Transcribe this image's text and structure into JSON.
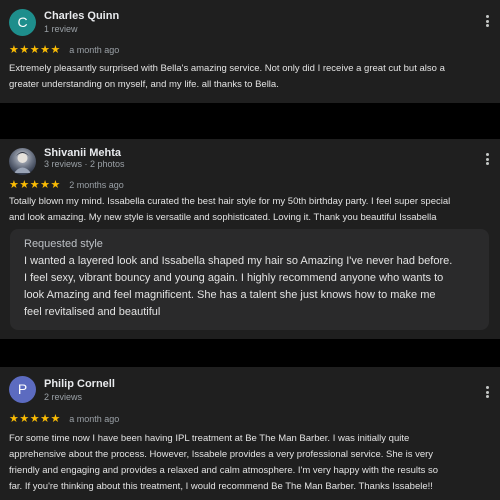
{
  "reviews": [
    {
      "initial": "C",
      "avatar_color": "#1e8e8c",
      "name": "Charles Quinn",
      "meta": "1 review",
      "stars": "★★★★★",
      "time": "a month ago",
      "body_lines": [
        "Extremely pleasantly surprised with Bella's amazing service. Not only did I receive a great cut but also a",
        "greater understanding on myself, and my life. all thanks to Bella."
      ]
    },
    {
      "initial": "",
      "avatar_color": "#3c4a66",
      "name": "Shivanii Mehta",
      "meta": "3 reviews · 2 photos",
      "stars": "★★★★★",
      "time": "2 months ago",
      "body_lines": [
        "Totally blown my mind. Issabella curated the best hair style for my 50th birthday party. I feel super special",
        "and look amazing. My new style is versatile and sophisticated. Loving it. Thank you beautiful Issabella"
      ],
      "requested_style": {
        "title": "Requested style",
        "lines": [
          "I wanted a layered look and Issabella shaped my hair so Amazing I've never had before.",
          "I feel sexy, vibrant bouncy and young again. I highly recommend anyone who wants to",
          "look Amazing and feel magnificent. She has a talent she just knows how to make me",
          "feel revitalised and beautiful"
        ]
      }
    },
    {
      "initial": "P",
      "avatar_color": "#5c6bc0",
      "name": "Philip Cornell",
      "meta": "2 reviews",
      "stars": "★★★★★",
      "time": "a month ago",
      "body_lines": [
        "For some time now I have been having IPL treatment at Be The Man Barber. I was initially quite",
        "apprehensive about the process. However, Issabele provides a very professional service. She is very",
        "friendly and engaging and provides a relaxed and calm atmosphere. I'm very happy with the results so",
        "far. If you're thinking about this treatment, I would recommend Be The Man Barber. Thanks Issabele!!"
      ]
    }
  ],
  "icons": {
    "menu": "more-vert-icon",
    "star": "star-icon"
  }
}
